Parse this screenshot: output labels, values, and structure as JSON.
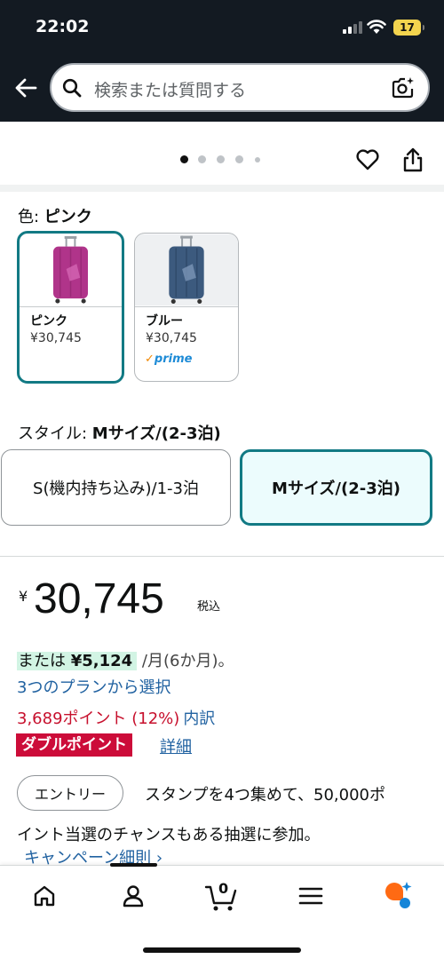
{
  "status_bar": {
    "time": "22:02",
    "battery": "17"
  },
  "search": {
    "placeholder": "検索または質問する"
  },
  "carousel": {
    "dots": 5,
    "active_index": 0
  },
  "color_selector": {
    "label": "色: ",
    "selected": "ピンク",
    "options": [
      {
        "name": "ピンク",
        "price": "¥30,745",
        "prime": false
      },
      {
        "name": "ブルー",
        "price": "¥30,745",
        "prime": true,
        "prime_label": "prime"
      }
    ]
  },
  "style_selector": {
    "label": "スタイル: ",
    "selected": "Mサイズ/(2-3泊)",
    "options": [
      "S(機内持ち込み)/1-3泊",
      "Mサイズ/(2-3泊)"
    ]
  },
  "price": {
    "currency": "¥",
    "amount": "30,745",
    "tax_label": "税込",
    "installment_prefix": "または",
    "installment_amount": "¥5,124",
    "installment_suffix": " /月(6か月)。",
    "plan_link": "3つのプランから選択",
    "points_text": "3,689ポイント (12%)",
    "points_breakdown": "内訳",
    "double_points": "ダブルポイント",
    "detail_link": "詳細"
  },
  "promo": {
    "entry_button": "エントリー",
    "text_line1": "スタンプを4つ集めて、50,000ポ",
    "text_line2": "イント当選のチャンスもある抽選に参加。",
    "campaign_link": "キャンペーン細則 ›"
  },
  "bottom_nav": {
    "cart_count": "0",
    "items": [
      "home-icon",
      "account-icon",
      "cart-icon",
      "menu-icon",
      "ai-assistant-icon"
    ]
  },
  "colors": {
    "header_bg": "#131a22",
    "selected_border": "#127a84",
    "link": "#2162a1",
    "points_red": "#c7102d",
    "badge_red": "#cc0c39",
    "installment_highlight": "#d2f4e4"
  }
}
